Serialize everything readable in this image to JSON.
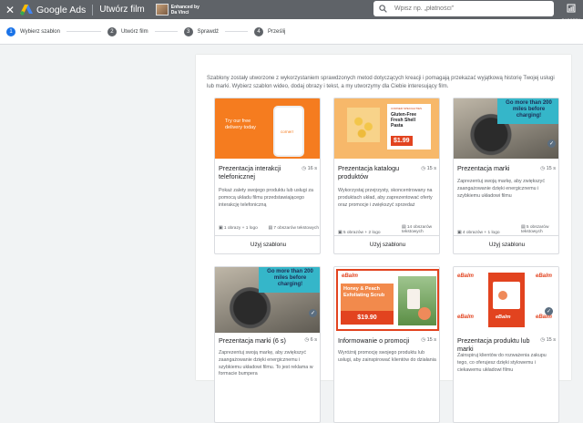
{
  "header": {
    "brand": "Google Ads",
    "title": "Utwórz film",
    "davinci_l1": "Enhanced by",
    "davinci_l2": "Da Vinci",
    "search_placeholder": "Wpisz np. „płatności”",
    "report_label": "RAPORTY"
  },
  "stepper": {
    "steps": [
      {
        "num": "1",
        "label": "Wybierz szablon",
        "active": true
      },
      {
        "num": "2",
        "label": "Utwórz film",
        "active": false
      },
      {
        "num": "3",
        "label": "Sprawdź",
        "active": false
      },
      {
        "num": "4",
        "label": "Prześlij",
        "active": false
      }
    ]
  },
  "intro": "Szablony zostały utworzone z wykorzystaniem sprawdzonych metod dotyczących kreacji i pomagają przekazać wyjątkową historię Twojej usługi lub marki. Wybierz szablon wideo, dodaj obrazy i tekst, a my utworzymy dla Ciebie interesujący film.",
  "cards": [
    {
      "title": "Prezentacja interakcji telefonicznej",
      "duration": "16 s",
      "description": "Pokaż zalety swojego produktu lub usługi za pomocą układu filmu przedstawiającego interakcję telefoniczną",
      "meta_images": "1 obrazy + 1 logo",
      "meta_text": "7 obszarów tekstowych",
      "use": "Użyj szablonu",
      "thumb_text": "Try our free delivery today",
      "thumb_brand": "cornerr"
    },
    {
      "title": "Prezentacja katalogu produktów",
      "duration": "15 s",
      "description": "Wykorzystaj przejrzysty, skoncentrowany na produktach układ, aby zaprezentować oferty oraz promocje i zwiększyć sprzedaż",
      "meta_images": "5 obrazów + 2 logo",
      "meta_text": "14 obszarów tekstowych",
      "use": "Użyj szablonu",
      "thumb_tag": "CORNER SPECIALITIES",
      "thumb_product": "Gluten-Free Fresh Shell Pasta",
      "thumb_price": "$1.99"
    },
    {
      "title": "Prezentacja marki",
      "duration": "15 s",
      "description": "Zaprezentuj swoją markę, aby zwiększyć zaangażowanie dzięki energicznemu i szybkiemu układowi filmu",
      "meta_images": "4 obrazów + 1 logo",
      "meta_text": "5 obszarów tekstowych",
      "use": "Użyj szablonu",
      "thumb_text": "Go more than 200 miles before charging!"
    },
    {
      "title": "Prezentacja marki (6 s)",
      "duration": "6 s",
      "description": "Zaprezentuj swoją markę, aby zwiększyć zaangażowanie dzięki energicznemu i szybkiemu układowi filmu. To jest reklama w formacie bumpera",
      "thumb_text": "Go more than 200 miles before charging!"
    },
    {
      "title": "Informowanie o promocji",
      "duration": "15 s",
      "description": "Wyróżnij promocję swojego produktu lub usługi, aby zainspirować klientów do działania",
      "thumb_logo": "eBalm",
      "thumb_product": "Honey & Peach Exfoliating Scrub",
      "thumb_price": "$19.90"
    },
    {
      "title": "Prezentacja produktu lub marki",
      "duration": "15 s",
      "description": "Zainspiruj klientów do rozważenia zakupu tego, co oferujesz dzięki stylowemu i ciekawemu układowi filmu",
      "thumb_logo": "eBalm"
    }
  ]
}
